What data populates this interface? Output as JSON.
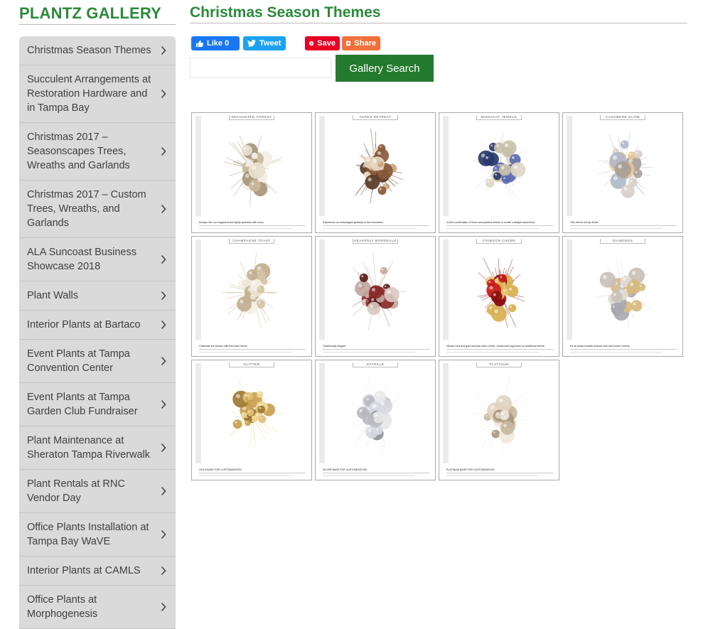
{
  "sidebar": {
    "title": "PLANTZ GALLERY",
    "items": [
      {
        "label": "Christmas Season Themes"
      },
      {
        "label": "Succulent Arrangements at Restoration Hardware and in Tampa Bay"
      },
      {
        "label": "Christmas 2017 – Seasonscapes Trees, Wreaths and Garlands"
      },
      {
        "label": "Christmas 2017 – Custom Trees, Wreaths, and Garlands"
      },
      {
        "label": "ALA Suncoast Business Showcase 2018"
      },
      {
        "label": "Plant Walls"
      },
      {
        "label": "Interior Plants at Bartaco"
      },
      {
        "label": "Event Plants at Tampa Convention Center"
      },
      {
        "label": "Event Plants at Tampa Garden Club Fundraiser"
      },
      {
        "label": "Plant Maintenance at Sheraton Tampa Riverwalk"
      },
      {
        "label": "Plant Rentals at RNC Vendor Day"
      },
      {
        "label": "Office Plants Installation at Tampa Bay WaVE"
      },
      {
        "label": "Interior Plants at CAMLS"
      },
      {
        "label": "Office Plants at Morphogenesis"
      }
    ]
  },
  "main": {
    "title": "Christmas Season Themes"
  },
  "share": {
    "facebook_label": "Like 0",
    "twitter_label": "Tweet",
    "pinterest_label": "Save",
    "share_label": "Share"
  },
  "search": {
    "button_label": "Gallery Search",
    "placeholder": ""
  },
  "gallery": [
    {
      "title": "ENCHANTED FOREST",
      "caption": "Escape into our magical forest lightly sprinkled with snow.",
      "colors": [
        "#e8dfd0",
        "#c9b79a",
        "#f4efe6",
        "#a7967a"
      ]
    },
    {
      "title": "ASPEN RETREAT",
      "caption": "Experience an extravagant getaway to the mountains.",
      "colors": [
        "#8a5a3a",
        "#c9a27a",
        "#e8d8c0",
        "#5a3a26"
      ]
    },
    {
      "title": "MIDNIGHT JEWELS",
      "caption": "A bold combination of blues and jeweled metals to create a twilight experience.",
      "colors": [
        "#2a3a6a",
        "#c8c0a8",
        "#5a6ab0",
        "#e0d8c8"
      ]
    },
    {
      "title": "CASHMERE GLOW",
      "caption": "This theme is truly divine.",
      "colors": [
        "#d8d0c8",
        "#a8a098",
        "#e8c890",
        "#b0b8c8"
      ]
    },
    {
      "title": "CHAMPAGNE TOAST",
      "caption": "Celebrate the season with this toast theme.",
      "colors": [
        "#ece4d4",
        "#d4c4a4",
        "#f4f0e8",
        "#c0b090"
      ]
    },
    {
      "title": "HEAVENLY BORDEAUX",
      "caption": "Traditionally elegant.",
      "colors": [
        "#8a2a2a",
        "#d8c8c0",
        "#5a1a1a",
        "#c0a8a0"
      ]
    },
    {
      "title": "CRIMSON CHEER",
      "caption": "Vibrant reds and gold accents mark a fresh, modernized approach on traditional theme.",
      "colors": [
        "#c81818",
        "#d8b050",
        "#e8c870",
        "#8a1010"
      ]
    },
    {
      "title": "DIAMONDS",
      "caption": "It's all about metallic finishes with this modern theme.",
      "colors": [
        "#c8c0b8",
        "#d8b880",
        "#a8a8b0",
        "#e0dcd4"
      ]
    },
    {
      "title": "GLITTER",
      "caption": "GOLD BASE FOR CUSTOMIZATION",
      "colors": [
        "#c8a050",
        "#e0c078",
        "#a07830",
        "#f0d898"
      ]
    },
    {
      "title": "SPARKLE",
      "caption": "SILVER BASE FOR CUSTOMIZATION",
      "colors": [
        "#b8b8c0",
        "#d8d8e0",
        "#909098",
        "#e8e8ec"
      ]
    },
    {
      "title": "PLATINUM",
      "caption": "PLATINUM BASE FOR CUSTOMIZATION",
      "colors": [
        "#c8b8a0",
        "#e0d4c0",
        "#a89880",
        "#f0e8dc"
      ]
    }
  ]
}
